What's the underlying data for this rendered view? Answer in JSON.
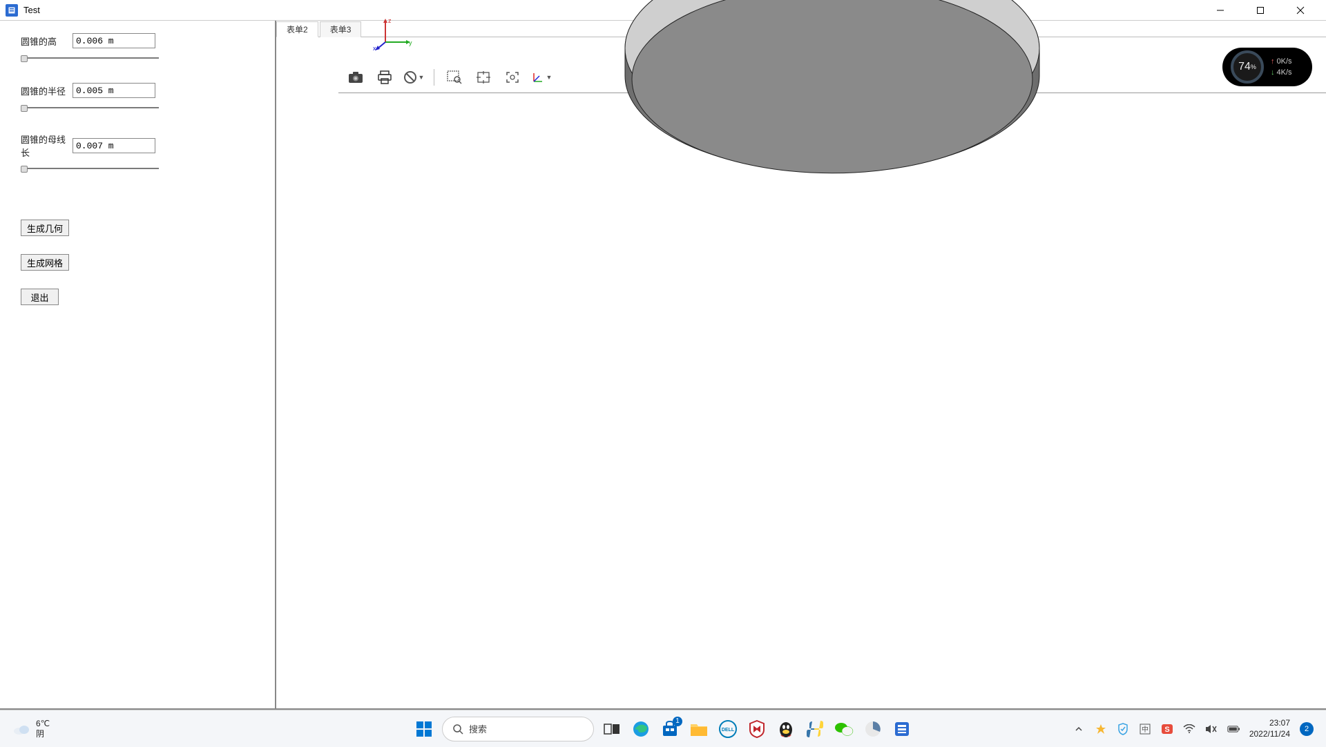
{
  "window": {
    "title": "Test"
  },
  "sidebar": {
    "params": [
      {
        "label": "圆锥的高",
        "value": "0.006 m"
      },
      {
        "label": "圆锥的半径",
        "value": "0.005 m"
      },
      {
        "label": "圆锥的母线长",
        "value": "0.007 m"
      }
    ],
    "buttons": {
      "gen_geom": "生成几何",
      "gen_mesh": "生成网格",
      "exit": "退出"
    }
  },
  "tabs": [
    {
      "label": "表单2",
      "active": true
    },
    {
      "label": "表单3",
      "active": false
    }
  ],
  "toolbar_icons": {
    "camera": "camera-icon",
    "print": "print-icon",
    "forbid": "forbid-icon",
    "zoom_window": "zoom-window-icon",
    "fit": "fit-icon",
    "zoom_all": "zoom-all-icon",
    "axes": "axes-icon"
  },
  "axis_labels": {
    "x": "x",
    "y": "y",
    "z": "z"
  },
  "netmeter": {
    "pct": "74",
    "pct_suffix": "%",
    "up": "0K/s",
    "down": "4K/s"
  },
  "weather": {
    "temp": "6℃",
    "cond": "阴"
  },
  "taskbar": {
    "search": "搜索",
    "store_badge": "1"
  },
  "clock": {
    "time": "23:07",
    "date": "2022/11/24",
    "notif": "2"
  },
  "colors": {
    "accent": "#0067c0",
    "viewport_top": "#c5d3e2",
    "viewport_bottom": "#dde6ef"
  }
}
